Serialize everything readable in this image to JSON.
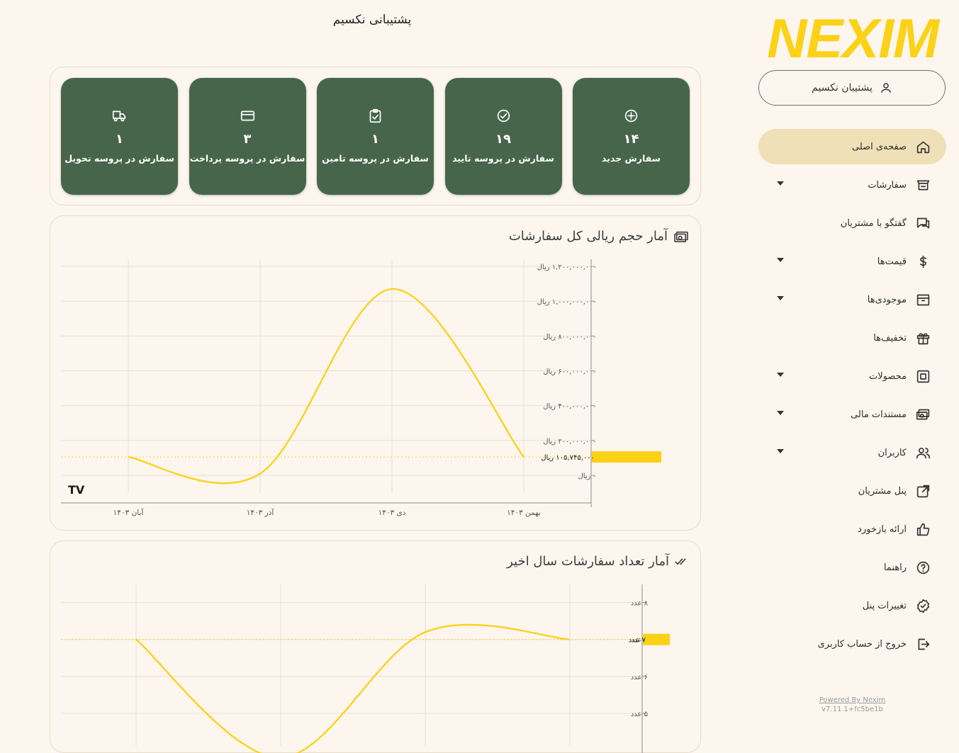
{
  "app": {
    "logo_text": "NEXIM",
    "brand_color": "#fcd116",
    "accent_green": "#47654b"
  },
  "user": {
    "name": "پشتیبان نکسیم",
    "icon": "user-icon"
  },
  "page": {
    "title": "پشتیبانی نکسیم"
  },
  "sidebar": {
    "items": [
      {
        "label": "صفحه‌ی اصلی",
        "icon": "home-icon",
        "active": true,
        "dropdown": false
      },
      {
        "label": "سفارشات",
        "icon": "cart-icon",
        "active": false,
        "dropdown": true
      },
      {
        "label": "گفتگو با مشتریان",
        "icon": "chat-icon",
        "active": false,
        "dropdown": false
      },
      {
        "label": "قیمت‌ها",
        "icon": "dollar-icon",
        "active": false,
        "dropdown": true
      },
      {
        "label": "موجودی‌ها",
        "icon": "archive-icon",
        "active": false,
        "dropdown": true
      },
      {
        "label": "تخفیف‌ها",
        "icon": "gift-icon",
        "active": false,
        "dropdown": false
      },
      {
        "label": "محصولات",
        "icon": "product-icon",
        "active": false,
        "dropdown": true
      },
      {
        "label": "مستندات مالی",
        "icon": "money-icon",
        "active": false,
        "dropdown": true
      },
      {
        "label": "کاربران",
        "icon": "users-icon",
        "active": false,
        "dropdown": true
      },
      {
        "label": "پنل مشتریان",
        "icon": "external-link-icon",
        "active": false,
        "dropdown": false
      },
      {
        "label": "ارائه بازخورد",
        "icon": "thumbs-up-icon",
        "active": false,
        "dropdown": false
      },
      {
        "label": "راهنما",
        "icon": "help-icon",
        "active": false,
        "dropdown": false
      },
      {
        "label": "تغییرات پنل",
        "icon": "badge-check-icon",
        "active": false,
        "dropdown": false
      },
      {
        "label": "خروج از حساب کاربری",
        "icon": "logout-icon",
        "active": false,
        "dropdown": false
      }
    ],
    "powered_by": "Powered By Nexim",
    "version": "v7.11.1+fc5be1b"
  },
  "status_cards": [
    {
      "icon": "plus-circle-icon",
      "value": "۱۴",
      "label": "سفارش جدید"
    },
    {
      "icon": "check-circle-icon",
      "value": "۱۹",
      "label": "سفارش در پروسه تایید"
    },
    {
      "icon": "clipboard-check-icon",
      "value": "۱",
      "label": "سفارش در پروسه تامین"
    },
    {
      "icon": "credit-card-icon",
      "value": "۳",
      "label": "سفارش در پروسه پرداخت"
    },
    {
      "icon": "truck-icon",
      "value": "۱",
      "label": "سفارش در پروسه تحویل"
    }
  ],
  "chart_data": [
    {
      "type": "line",
      "title": "آمار حجم ریالی کل سفارشات",
      "title_icon": "money-icon",
      "line_color": "#fcd116",
      "x": [
        "آبان ۱۴۰۳",
        "آذر ۱۴۰۳",
        "دی ۱۴۰۳",
        "بهمن ۱۴۰۳"
      ],
      "y": [
        105000000,
        10000000,
        1070000000,
        105745000
      ],
      "y_ticks": [
        {
          "value": 0,
          "label": "۰ ریال"
        },
        {
          "value": 200000000,
          "label": "۲۰۰,۰۰۰,۰۰۰ ریال"
        },
        {
          "value": 400000000,
          "label": "۴۰۰,۰۰۰,۰۰۰ ریال"
        },
        {
          "value": 600000000,
          "label": "۶۰۰,۰۰۰,۰۰۰ ریال"
        },
        {
          "value": 800000000,
          "label": "۸۰۰,۰۰۰,۰۰۰ ریال"
        },
        {
          "value": 1000000000,
          "label": "۱,۰۰۰,۰۰۰,۰۰۰ ریال"
        },
        {
          "value": 1200000000,
          "label": "۱,۲۰۰,۰۰۰,۰۰۰ ریال"
        }
      ],
      "last_value_label": "۱۰۵,۷۴۵,۰۰۰ ریال",
      "last_value": 105745000,
      "ylim": [
        -20000000,
        1200000000
      ],
      "watermark": "TV",
      "grid": true
    },
    {
      "type": "line",
      "title": "آمار تعداد سفارشات سال اخیر",
      "title_icon": "double-check-icon",
      "line_color": "#fcd116",
      "x_count": 4,
      "y": [
        7,
        3.8,
        7.2,
        7
      ],
      "y_ticks": [
        {
          "value": 5,
          "label": "۵ عدد"
        },
        {
          "value": 6,
          "label": "۶ عدد"
        },
        {
          "value": 7,
          "label": "۷ عدد"
        },
        {
          "value": 8,
          "label": "۸ عدد"
        }
      ],
      "last_value_label": "۷ عدد",
      "last_value": 7,
      "ylim": [
        4.5,
        8.3
      ],
      "grid": true
    }
  ]
}
